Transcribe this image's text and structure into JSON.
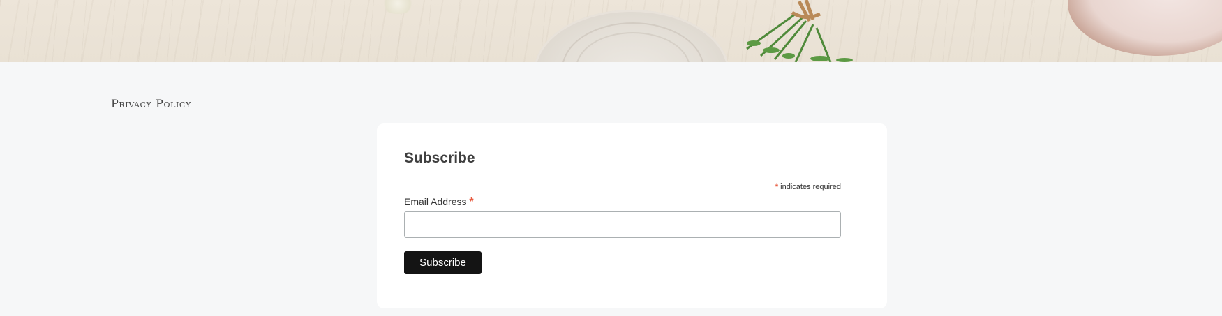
{
  "footer": {
    "privacy_link": "Privacy Policy"
  },
  "subscribe_form": {
    "title": "Subscribe",
    "required_marker": "*",
    "required_note": "indicates required",
    "email_label": "Email Address",
    "email_value": "",
    "email_placeholder": "",
    "submit_label": "Subscribe"
  },
  "colors": {
    "page_background": "#f6f7f8",
    "card_background": "#ffffff",
    "button_background": "#141414",
    "required_marker": "#e85c41"
  }
}
